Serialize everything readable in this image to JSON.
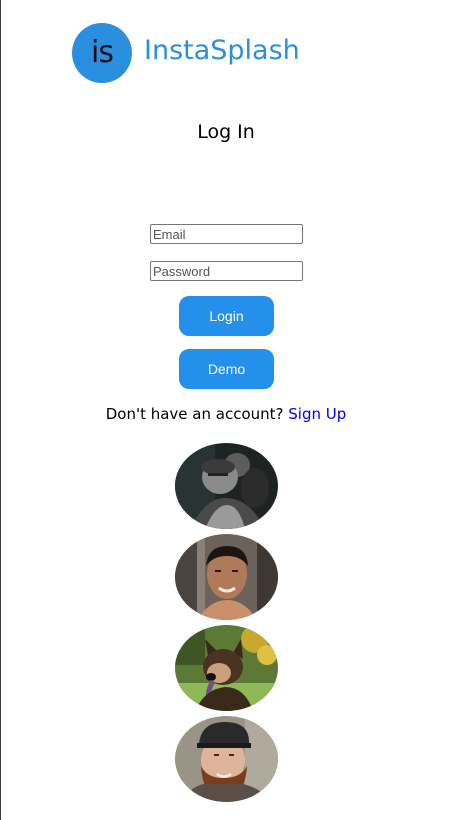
{
  "brand": {
    "logo_text": "is",
    "name": "InstaSplash",
    "accent_color": "#2b8fe0"
  },
  "page": {
    "title": "Log In"
  },
  "form": {
    "email_placeholder": "Email",
    "email_value": "",
    "password_placeholder": "Password",
    "password_value": "",
    "login_label": "Login",
    "demo_label": "Demo",
    "button_color": "#2490eb"
  },
  "signup": {
    "prompt": "Don't have an account? ",
    "link_label": "Sign Up"
  },
  "avatars": [
    {
      "name": "avatar-photo-1",
      "description_icon": "person-photo"
    },
    {
      "name": "avatar-photo-2",
      "description_icon": "person-photo"
    },
    {
      "name": "avatar-photo-3",
      "description_icon": "dog-photo"
    },
    {
      "name": "avatar-photo-4",
      "description_icon": "person-photo"
    }
  ]
}
